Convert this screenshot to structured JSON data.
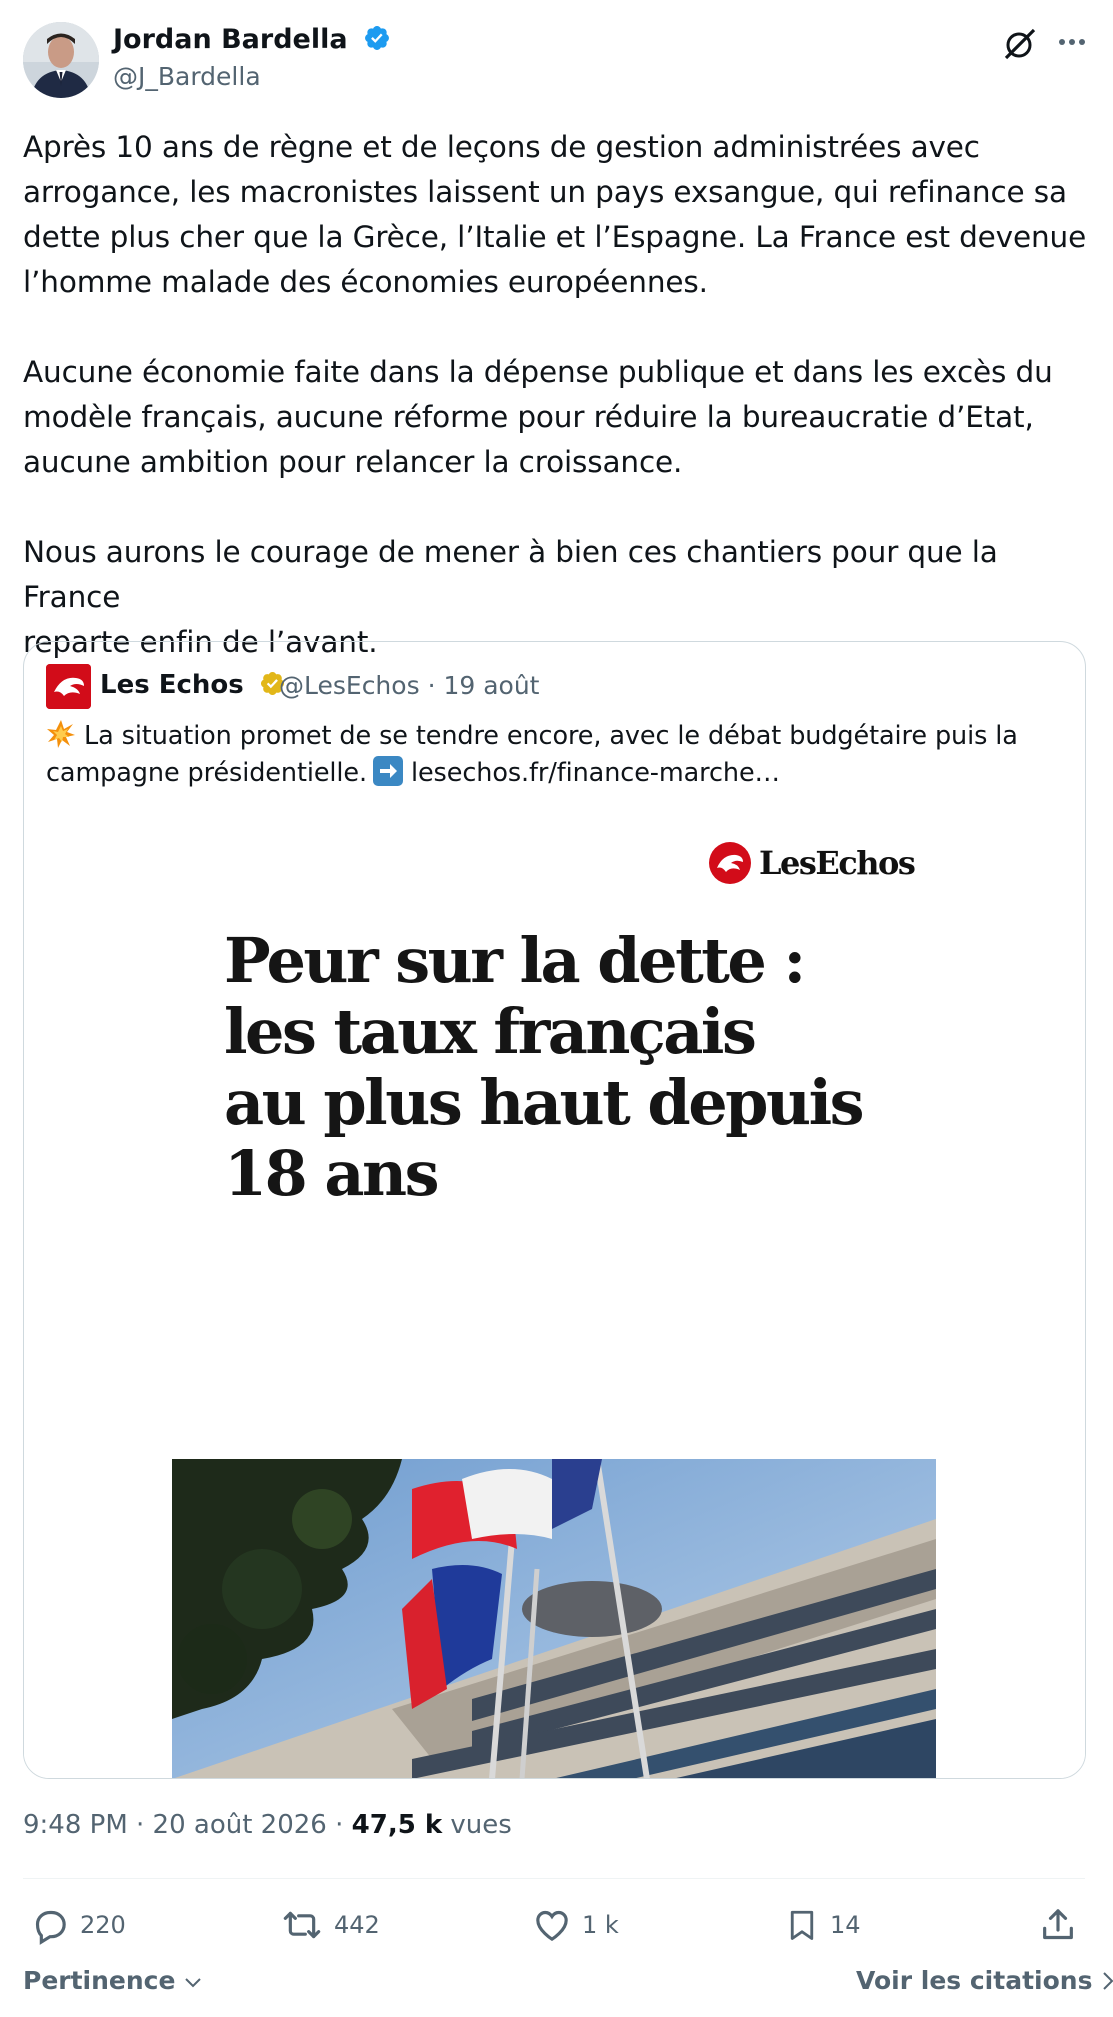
{
  "author": {
    "name": "Jordan Bardella",
    "handle": "@J_Bardella"
  },
  "post": {
    "text": "Après 10 ans de règne et de leçons de gestion administrées avec\narrogance, les macronistes laissent un pays exsangue, qui refinance sa\ndette plus cher que la Grèce, l’Italie et l’Espagne. La France est devenue\nl’homme malade des économies européennes.\n\nAucune économie faite dans la dépense publique et dans les excès du\nmodèle français, aucune réforme pour réduire la bureaucratie d’Etat,\naucune ambition pour relancer la croissance.\n\nNous aurons le courage de mener à bien ces chantiers pour que la France\nreparte enfin de l’avant."
  },
  "quote": {
    "name": "Les Echos",
    "handle": "@LesEchos",
    "date": "· 19 août",
    "text_line1": "La situation promet de se tendre encore, avec le débat budgétaire puis la",
    "text_line2a": "campagne présidentielle.",
    "link": "lesechos.fr/finance-marche…",
    "article": {
      "brand": "LesEchos",
      "headline": "Peur sur la dette :\nles taux français\nau plus haut depuis\n18 ans"
    }
  },
  "meta": {
    "time": "9:48 PM · 20 août 2026 · ",
    "views_count": "47,5 k",
    "views_label": " vues"
  },
  "actions": {
    "replies": "220",
    "reposts": "442",
    "likes": "1 k",
    "bookmarks": "14"
  },
  "footer": {
    "sort_label": "Pertinence",
    "quotes_link": "Voir les citations"
  },
  "colors": {
    "text": "#0f1419",
    "secondary": "#536471",
    "verified_blue": "#1d9bf0",
    "verified_gold": "#e2b719",
    "brand_red": "#d20c19"
  }
}
